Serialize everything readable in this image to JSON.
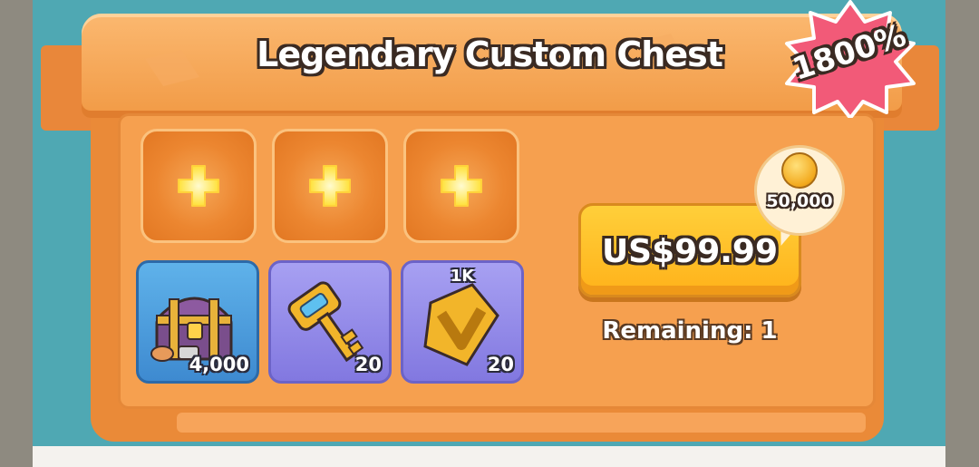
{
  "header": {
    "title": "Legendary Custom Chest"
  },
  "badge": {
    "label": "1800%"
  },
  "slots": [
    {
      "icon": "plus-icon"
    },
    {
      "icon": "plus-icon"
    },
    {
      "icon": "plus-icon"
    }
  ],
  "rewards": [
    {
      "icon": "treasure-chest-icon",
      "count": "4,000",
      "top_label": ""
    },
    {
      "icon": "golden-key-icon",
      "count": "20",
      "top_label": ""
    },
    {
      "icon": "gold-shield-chevron-icon",
      "count": "20",
      "top_label": "1K"
    }
  ],
  "purchase": {
    "price_label": "US$99.99",
    "remaining_label": "Remaining: 1",
    "bonus_amount": "50,000",
    "bonus_icon": "gold-coin-icon"
  },
  "colors": {
    "background": "#4fa8b3",
    "panel": "#f6a04f",
    "button": "#ffc12a",
    "badge": "#f25a78"
  }
}
